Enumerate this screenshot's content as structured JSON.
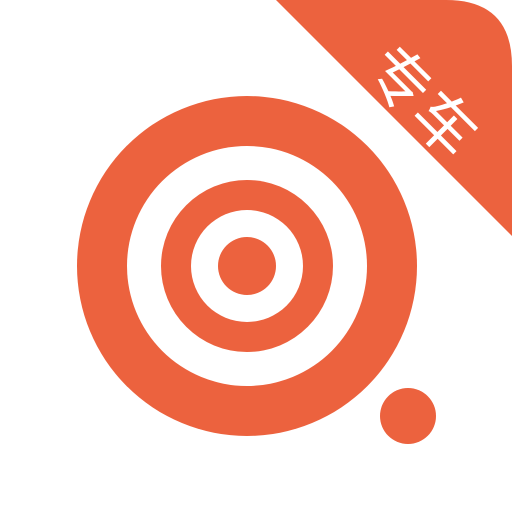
{
  "colors": {
    "brand": "#EC623E",
    "background": "#FFFFFF"
  },
  "badge": {
    "label": "专车"
  },
  "icons": {
    "logo": "target-rings-icon",
    "dot": "dot-icon"
  }
}
